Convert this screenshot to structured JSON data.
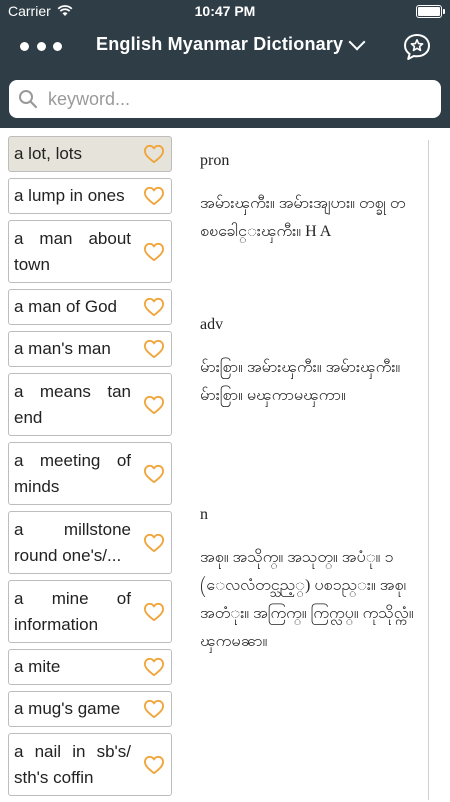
{
  "status": {
    "carrier": "Carrier",
    "time": "10:47 PM"
  },
  "nav": {
    "title": "English Myanmar Dictionary",
    "menu_icon": "ellipsis-icon",
    "fav_icon": "star-speech-bubble-icon"
  },
  "search": {
    "placeholder": "keyword...",
    "value": ""
  },
  "words": [
    {
      "label": "a lot, lots",
      "selected": true
    },
    {
      "label": "a lump in ones"
    },
    {
      "label": "a man about town"
    },
    {
      "label": "a man of God"
    },
    {
      "label": "a man's man"
    },
    {
      "label": "a means tan end"
    },
    {
      "label": "a meeting of minds"
    },
    {
      "label": "a millstone round one's/..."
    },
    {
      "label": "a mine of information"
    },
    {
      "label": "a mite"
    },
    {
      "label": "a mug's game"
    },
    {
      "label": "a nail in sb's/ sth's coffin"
    }
  ],
  "definition": [
    {
      "pos": "pron",
      "text": "အမ်ားၾကီး။ အမ်ားအျပား။ တစ္ခု တစၿခေါင္းၾကီး။ H A"
    },
    {
      "pos": "adv",
      "text": "မ်ားစြာ။ အမ်ားၾကီး။ အမ်ားၾကီး။ မ်ားစြာ။ မၾကာမၾကာ။"
    },
    {
      "pos": "n",
      "text": "အစု။ အသိုက္။ အသုတ္။ အပံု။ ၁ (ေလလံတင္သည့္) ပစၥည္း။ အစု၊ အတံုး။ အကြက္။ ကြက္လပ္။ ကုသိုလ္ကံ။ ၾကမၼာ။"
    }
  ],
  "colors": {
    "header": "#2f3e46",
    "heart": "#f0a53a",
    "selected_row": "#e6e3da"
  }
}
